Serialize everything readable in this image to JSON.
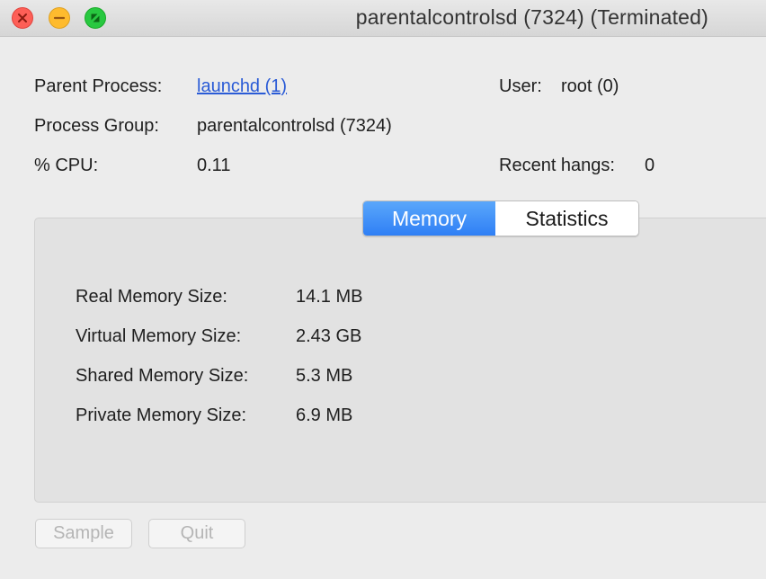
{
  "window": {
    "title": "parentalcontrolsd (7324) (Terminated)",
    "controls": [
      "close-icon",
      "minimize-icon",
      "zoom-icon"
    ]
  },
  "info": {
    "parent_process_label": "Parent Process:",
    "parent_process_value": "launchd (1)",
    "user_label": "User:",
    "user_value": "root (0)",
    "process_group_label": "Process Group:",
    "process_group_value": "parentalcontrolsd (7324)",
    "cpu_label": "% CPU:",
    "cpu_value": "0.11",
    "recent_hangs_label": "Recent hangs:",
    "recent_hangs_value": "0"
  },
  "tabs": [
    {
      "label": "Memory",
      "selected": true
    },
    {
      "label": "Statistics",
      "selected": false
    }
  ],
  "memory": {
    "rows": [
      {
        "label": "Real Memory Size:",
        "value": "14.1 MB"
      },
      {
        "label": "Virtual Memory Size:",
        "value": "2.43 GB"
      },
      {
        "label": "Shared Memory Size:",
        "value": "5.3 MB"
      },
      {
        "label": "Private Memory Size:",
        "value": "6.9 MB"
      }
    ]
  },
  "buttons": {
    "sample_label": "Sample",
    "quit_label": "Quit",
    "enabled": false
  },
  "colors": {
    "accent": "#2f7ff5",
    "link": "#2a5bd6",
    "close": "#fd5f57",
    "minimize": "#febb2e",
    "zoom": "#28c840"
  }
}
